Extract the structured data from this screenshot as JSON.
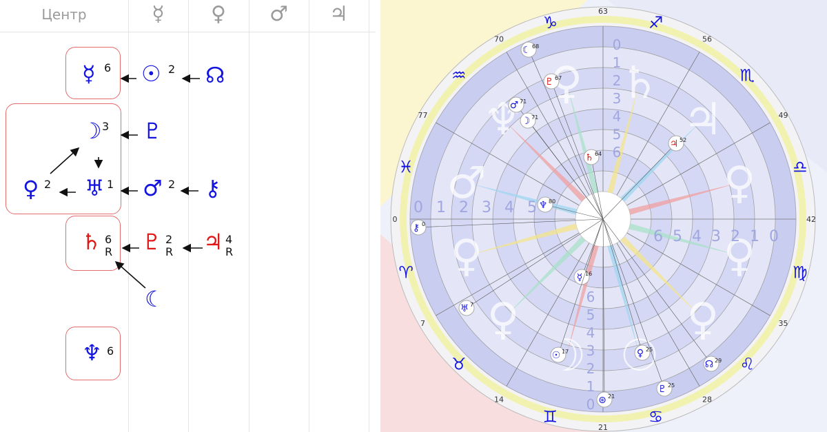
{
  "table": {
    "headers": [
      {
        "id": "center",
        "text": "Центр"
      },
      {
        "id": "mercury",
        "text": "☿"
      },
      {
        "id": "venus",
        "text": "♀"
      },
      {
        "id": "mars",
        "text": "♂"
      },
      {
        "id": "jupiter",
        "text": "♃"
      }
    ],
    "planets": {
      "mercury_center": {
        "glyph": "☿",
        "num": "6"
      },
      "sun": {
        "glyph": "☉",
        "num": "2"
      },
      "node": {
        "glyph": "☊"
      },
      "moon": {
        "glyph": "☽",
        "num": "3"
      },
      "pluto_top": {
        "glyph": "♇"
      },
      "venus": {
        "glyph": "♀",
        "num": "2"
      },
      "uranus": {
        "glyph": "♅",
        "num": "1"
      },
      "mars": {
        "glyph": "♂",
        "num": "2"
      },
      "chiron": {
        "glyph": "⚷"
      },
      "saturn": {
        "glyph": "♄",
        "num": "6",
        "r": "R"
      },
      "pluto_red": {
        "glyph": "♇",
        "num": "2",
        "r": "R"
      },
      "jupiter": {
        "glyph": "♃",
        "num": "4",
        "r": "R"
      },
      "lilith": {
        "glyph": "☾"
      },
      "neptune": {
        "glyph": "♆",
        "num": "6"
      }
    }
  },
  "wheel": {
    "colors": {
      "blue": "#1414e0",
      "red": "#e01818",
      "ring": "#c9cdf0",
      "box": "#e36b6b"
    },
    "zodiac": [
      "♑",
      "♐",
      "♏",
      "♎",
      "♍",
      "♌",
      "♋",
      "♊",
      "♉",
      "♈",
      "♓",
      "♒"
    ],
    "outer_numbers": [
      "63",
      "56",
      "49",
      "42",
      "35",
      "28",
      "21",
      "14",
      "7",
      "0",
      "77",
      "70"
    ],
    "big_house_planets": [
      "♄",
      "♃",
      "♀",
      "♀",
      "♀",
      "☉",
      "☽",
      "♀",
      "♀",
      "♂",
      "♆",
      "♀"
    ],
    "planets": [
      {
        "g": "☾",
        "n": "68",
        "c": "blue"
      },
      {
        "g": "♇",
        "n": "67",
        "c": "red"
      },
      {
        "g": "♂",
        "n": "71",
        "c": "blue"
      },
      {
        "g": "☽",
        "n": "71",
        "c": "blue"
      },
      {
        "g": "♄",
        "n": "64",
        "c": "red"
      },
      {
        "g": "♃",
        "n": "52",
        "c": "red"
      },
      {
        "g": "♆",
        "n": "80",
        "c": "blue"
      },
      {
        "g": "⚷",
        "n": "0",
        "c": "blue"
      },
      {
        "g": "☿",
        "n": "16",
        "c": "blue"
      },
      {
        "g": "♅",
        "n": "7",
        "c": "blue"
      },
      {
        "g": "☉",
        "n": "17",
        "c": "blue"
      },
      {
        "g": "♀",
        "n": "25",
        "c": "blue"
      },
      {
        "g": "☊",
        "n": "29",
        "c": "blue"
      },
      {
        "g": "♇",
        "n": "25",
        "c": "blue"
      },
      {
        "g": "⊛",
        "n": "21",
        "c": "blue"
      }
    ],
    "rings": {
      "left": [
        "0",
        "1",
        "2",
        "3",
        "4",
        "5"
      ],
      "right": [
        "6",
        "5",
        "4",
        "3",
        "2",
        "1",
        "0"
      ],
      "top": [
        "6",
        "5",
        "4",
        "3",
        "2",
        "1",
        "0"
      ],
      "bottom": [
        "6",
        "5",
        "4",
        "3",
        "2",
        "1",
        "0"
      ]
    }
  }
}
